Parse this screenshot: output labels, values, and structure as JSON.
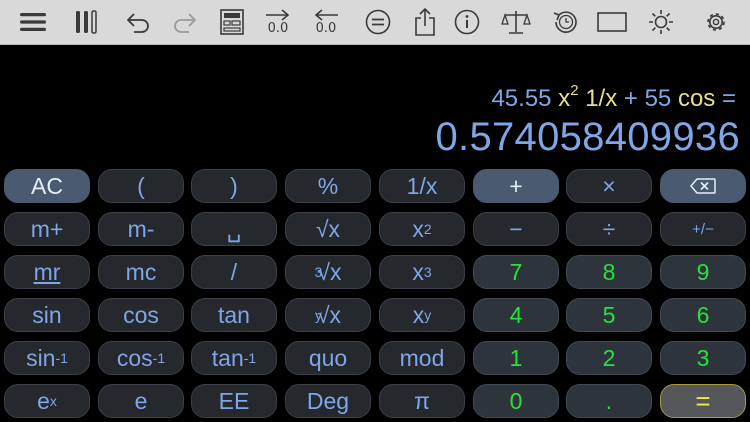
{
  "toolbar": {
    "buttons": [
      {
        "icon": "menu-icon"
      },
      {
        "icon": "columns-icon"
      },
      {
        "icon": "undo-icon"
      },
      {
        "icon": "redo-icon"
      },
      {
        "icon": "layout-icon"
      },
      {
        "icon": "move-right-icon",
        "label": "0.0"
      },
      {
        "icon": "move-left-icon",
        "label": "0.0"
      },
      {
        "icon": "equals-circle-icon"
      },
      {
        "icon": "share-icon"
      },
      {
        "icon": "info-icon"
      },
      {
        "icon": "scale-icon"
      },
      {
        "icon": "history-icon"
      },
      {
        "icon": "window-icon"
      },
      {
        "icon": "brightness-icon"
      },
      {
        "icon": "settings-icon"
      }
    ]
  },
  "display": {
    "expression": {
      "t1": "45.55 ",
      "t2": "x",
      "t2sup": "2",
      "t3": " 1/x",
      "t4": " + ",
      "t5": "55 ",
      "t6": "cos",
      "t7": " ="
    },
    "result": "0.574058409936"
  },
  "keypad": {
    "k_ac": "AC",
    "k_lparen": "(",
    "k_rparen": ")",
    "k_percent": "%",
    "k_recip": "1/x",
    "k_plus": "+",
    "k_times": "×",
    "k_mplus": "m+",
    "k_mminus": "m-",
    "k_space": "␣",
    "k_sqrt": "√x",
    "k_xsq": "x",
    "k_xsq_sup": "2",
    "k_minus": "−",
    "k_div": "÷",
    "k_pm": "+/−",
    "k_mr": "mr",
    "k_mc": "mc",
    "k_slash": "/",
    "k_cbrt_pre": "3",
    "k_cbrt": "√x",
    "k_xcube": "x",
    "k_xcube_sup": "3",
    "k_7": "7",
    "k_8": "8",
    "k_9": "9",
    "k_sin": "sin",
    "k_cos": "cos",
    "k_tan": "tan",
    "k_yroot_pre": "y",
    "k_yroot": "√x",
    "k_xy": "x",
    "k_xy_sup": "y",
    "k_4": "4",
    "k_5": "5",
    "k_6": "6",
    "k_asin": "sin",
    "k_asin_sup": "-1",
    "k_acos": "cos",
    "k_acos_sup": "-1",
    "k_atan": "tan",
    "k_atan_sup": "-1",
    "k_quo": "quo",
    "k_mod": "mod",
    "k_1": "1",
    "k_2": "2",
    "k_3": "3",
    "k_ex": "e",
    "k_ex_sup": "x",
    "k_e": "e",
    "k_ee": "EE",
    "k_deg": "Deg",
    "k_pi": "π",
    "k_0": "0",
    "k_dot": ".",
    "k_eq": "="
  },
  "colors": {
    "toolbar_bg": "#d9d9d9",
    "background": "#000000",
    "key_bg": "#25282d",
    "key_text": "#7fa6e6",
    "number_text": "#27e23a",
    "equals_text": "#f0e84a",
    "operator_text": "#e8df8c"
  }
}
